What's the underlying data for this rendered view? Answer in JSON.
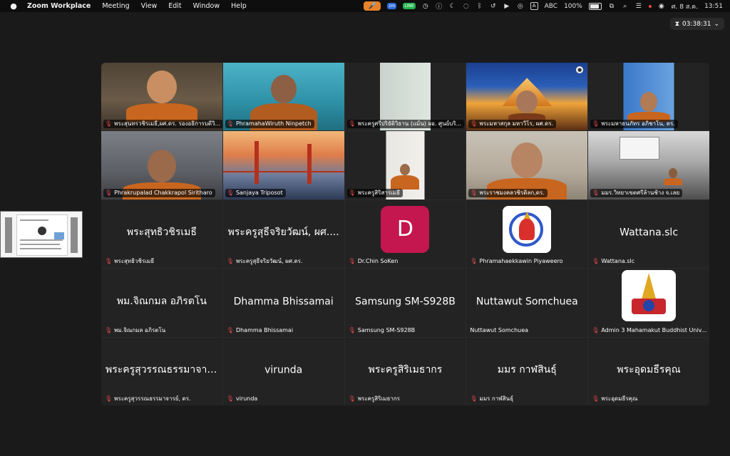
{
  "menubar": {
    "apple_icon": "apple-icon",
    "app_name": "Zoom Workplace",
    "menus": [
      "Meeting",
      "View",
      "Edit",
      "Window",
      "Help"
    ],
    "zoom_badge": "zm",
    "line_badge": "LINE",
    "input_source_box": "A",
    "input_source": "ABC",
    "battery_percent": "100%",
    "battery_level": 1.0,
    "date": "ศ. 8 ส.ค.",
    "time": "13:51"
  },
  "meeting": {
    "timer": "03:38:31",
    "colors": {
      "accent_orange": "#e8822a",
      "mute_red": "#e5484d",
      "avatar_pink": "#c4174f"
    }
  },
  "tiles": [
    {
      "name": "พระสุนทรวชิรเมธี,ผศ.ดร. รองอธิการบดีวิ...",
      "kind": "video",
      "bg": "office"
    },
    {
      "name": "PhramahaWiruth Ninpetch",
      "kind": "video",
      "bg": "teal"
    },
    {
      "name": "พระครูศรีปริยัติวิธาน (แม้น) ผอ. ศูนย์บริ...",
      "kind": "video",
      "bg": "blind"
    },
    {
      "name": "พระมหาสกุล มหาวีโร, ผศ.ดร.",
      "kind": "video",
      "bg": "temple"
    },
    {
      "name": "พระมหาธนภัทร อภิชาโน, ดร.",
      "kind": "video",
      "bg": "blue-wall"
    },
    {
      "name": "Phrakrupalad Chakkrapol Siritharo",
      "kind": "video",
      "bg": "brick"
    },
    {
      "name": "Sanjaya Triposot",
      "kind": "video",
      "bg": "bridge"
    },
    {
      "name": "พระครูสิริสารเมธี",
      "kind": "video",
      "bg": "wall"
    },
    {
      "name": "พระราชมงคลวชิรดิลก,ดร.",
      "kind": "video",
      "bg": "room"
    },
    {
      "name": "มมร.วิทยาเขตศรีล้านช้าง จ.เลย",
      "kind": "video",
      "bg": "meeting"
    },
    {
      "name": "พระสุทธิวชิรเมธี",
      "display": "พระสุทธิวชิรเมธี",
      "kind": "audio"
    },
    {
      "name": "พระครูสุธีจริยวัฒน์, ผศ.ดร.",
      "display": "พระครูสุธีจริยวัฒน์, ผศ....",
      "kind": "audio"
    },
    {
      "name": "Dr.Chin SoKen",
      "kind": "avatar",
      "avatar_letter": "D"
    },
    {
      "name": "Phramahaekkawin Piyaweero",
      "kind": "logo"
    },
    {
      "name": "Wattana.slc",
      "display": "Wattana.slc",
      "kind": "audio"
    },
    {
      "name": "พม.จิณกมล อภิรตโน",
      "display": "พม.จิณกมล อภิรตโน",
      "kind": "audio"
    },
    {
      "name": "Dhamma Bhissamai",
      "display": "Dhamma Bhissamai",
      "kind": "audio"
    },
    {
      "name": "Samsung SM-S928B",
      "display": "Samsung SM-S928B",
      "kind": "audio"
    },
    {
      "name": "Nuttawut Somchuea",
      "display": "Nuttawut Somchuea",
      "kind": "audio-nomute"
    },
    {
      "name": "Admin 3 Mahamakut Buddhist Univ...",
      "kind": "logo2"
    },
    {
      "name": "พระครูสุวรรณธรรมาจารย์, ดร.",
      "display": "พระครูสุวรรณธรรมาจาร...",
      "kind": "audio"
    },
    {
      "name": "virunda",
      "display": "virunda",
      "kind": "audio"
    },
    {
      "name": "พระครูสิริเมธากร",
      "display": "พระครูสิริเมธากร",
      "kind": "audio"
    },
    {
      "name": "มมร กาฬสินธุ์",
      "display": "มมร กาฬสินธุ์",
      "kind": "audio"
    },
    {
      "name": "พระอุดมธีรคุณ",
      "display": "พระอุดมธีรคุณ",
      "kind": "audio"
    }
  ]
}
